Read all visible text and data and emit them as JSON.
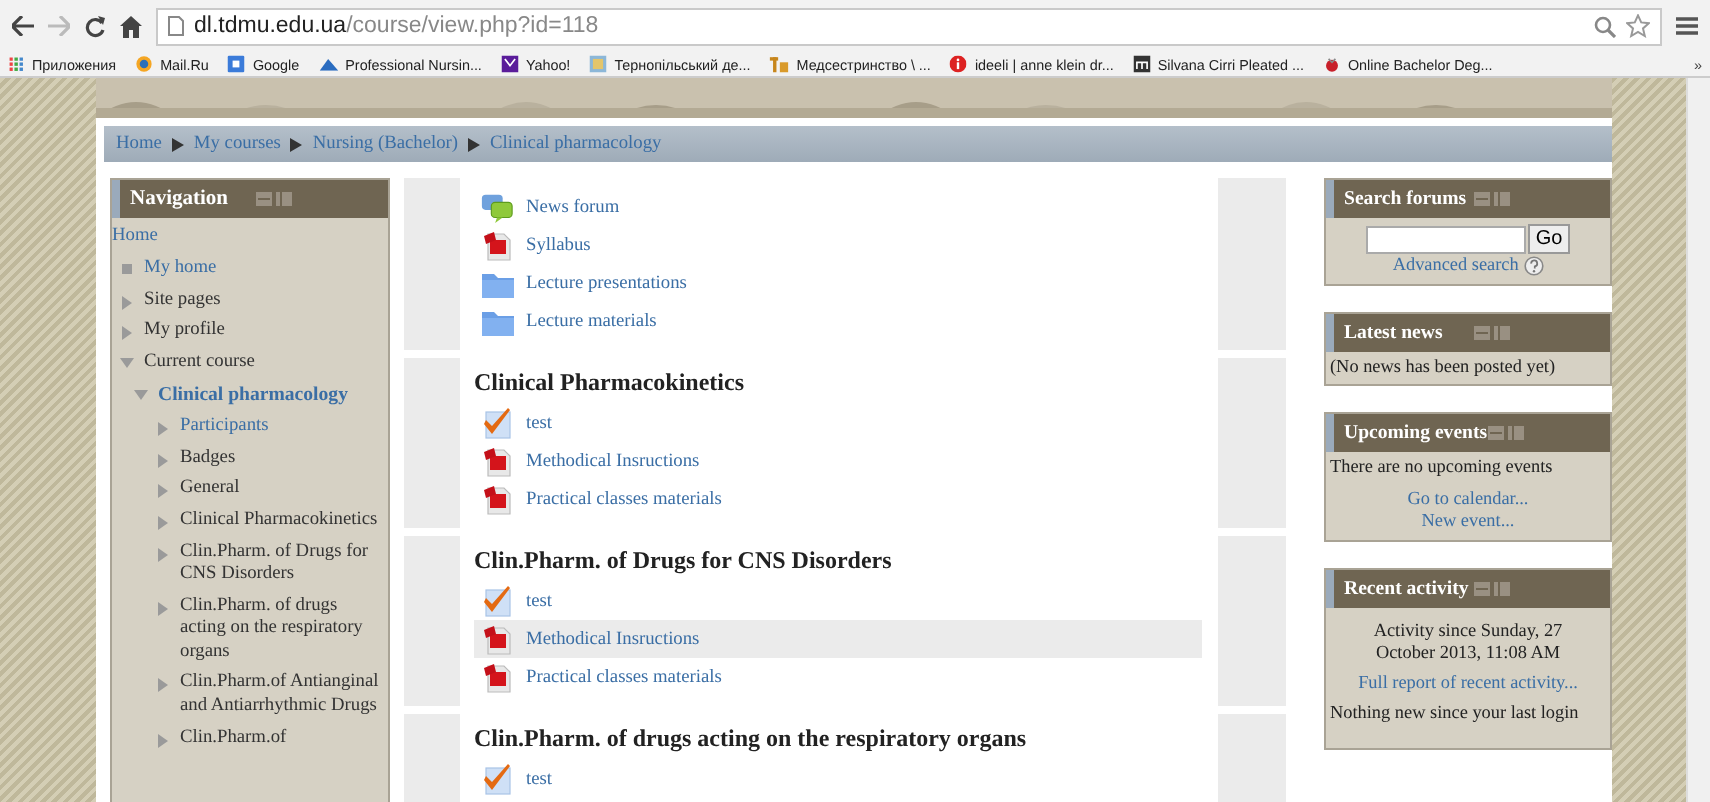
{
  "browser": {
    "url_host": "dl.tdmu.edu.ua",
    "url_path": "/course/view.php?id=118",
    "bookmarks": [
      {
        "kind": "apps",
        "label": "Приложения"
      },
      {
        "kind": "mail",
        "label": "Mail.Ru"
      },
      {
        "kind": "google",
        "label": "Google"
      },
      {
        "kind": "wave",
        "label": "Professional Nursin..."
      },
      {
        "kind": "yahoo",
        "label": "Yahoo!"
      },
      {
        "kind": "site",
        "label": "Тернопільський де..."
      },
      {
        "kind": "tn",
        "label": "Медсестринство \\ ..."
      },
      {
        "kind": "info",
        "label": "ideeli | anne klein dr..."
      },
      {
        "kind": "m",
        "label": "Silvana Cirri Pleated ..."
      },
      {
        "kind": "bird",
        "label": "Online Bachelor Deg..."
      }
    ],
    "more": "»"
  },
  "breadcrumb": [
    "Home",
    "My courses",
    "Nursing (Bachelor)",
    "Clinical pharmacology"
  ],
  "navigation": {
    "title": "Navigation",
    "items": [
      {
        "label": "Home",
        "kind": "plain",
        "link": true
      },
      {
        "label": "My home",
        "kind": "leaf",
        "link": true
      },
      {
        "label": "Site pages",
        "kind": "branch",
        "expanded": false,
        "link": false
      },
      {
        "label": "My profile",
        "kind": "branch",
        "expanded": false,
        "link": false
      },
      {
        "label": "Current course",
        "kind": "branch",
        "expanded": true,
        "link": false,
        "children": [
          {
            "label": "Clinical pharmacology",
            "kind": "branch",
            "expanded": true,
            "link": true,
            "current": true,
            "children": [
              {
                "label": "Participants",
                "kind": "branch",
                "expanded": false,
                "link": true
              },
              {
                "label": "Badges",
                "kind": "branch",
                "expanded": false,
                "link": false
              },
              {
                "label": "General",
                "kind": "branch",
                "expanded": false,
                "link": false
              },
              {
                "label": "Clinical Pharmacokinetics",
                "kind": "branch",
                "expanded": false,
                "link": false
              },
              {
                "label": "Clin.Pharm. of Drugs for CNS Disorders",
                "kind": "branch",
                "expanded": false,
                "link": false
              },
              {
                "label": "Clin.Pharm. of drugs acting on the respiratory organs",
                "kind": "branch",
                "expanded": false,
                "link": false
              },
              {
                "label": "Clin.Pharm.of Antianginal and Antiarrhythmic Drugs",
                "kind": "branch",
                "expanded": false,
                "link": false
              },
              {
                "label": "Clin.Pharm.of",
                "kind": "branch",
                "expanded": false,
                "link": false
              }
            ]
          }
        ]
      }
    ]
  },
  "sections": [
    {
      "activities": [
        {
          "kind": "forum",
          "label": "News forum",
          "highlighted": false
        },
        {
          "kind": "pdf",
          "label": "Syllabus",
          "highlighted": false
        },
        {
          "kind": "folder",
          "label": "Lecture presentations",
          "highlighted": false
        },
        {
          "kind": "folder",
          "label": "Lecture materials",
          "highlighted": false
        }
      ]
    },
    {
      "title": "Clinical Pharmacokinetics",
      "activities": [
        {
          "kind": "quiz",
          "label": "test",
          "highlighted": false
        },
        {
          "kind": "pdf",
          "label": "Methodical Insructions",
          "highlighted": false
        },
        {
          "kind": "pdf",
          "label": "Practical classes materials",
          "highlighted": false
        }
      ]
    },
    {
      "title": "Clin.Pharm. of Drugs for CNS Disorders",
      "activities": [
        {
          "kind": "quiz",
          "label": "test",
          "highlighted": false
        },
        {
          "kind": "pdf",
          "label": "Methodical Insructions",
          "highlighted": true
        },
        {
          "kind": "pdf",
          "label": "Practical classes materials",
          "highlighted": false
        }
      ]
    },
    {
      "title": "Clin.Pharm. of drugs acting on the respiratory organs",
      "activities": [
        {
          "kind": "quiz",
          "label": "test",
          "highlighted": false
        }
      ]
    }
  ],
  "blocks": [
    {
      "kind": "search",
      "title": "Search forums",
      "button": "Go",
      "link": "Advanced search"
    },
    {
      "kind": "text",
      "title": "Latest news",
      "text": "(No news has been posted yet)"
    },
    {
      "kind": "events",
      "title": "Upcoming events",
      "text": "There are no upcoming events",
      "links": [
        "Go to calendar...",
        "New event..."
      ]
    },
    {
      "kind": "activity",
      "title": "Recent activity",
      "since": "Activity since Sunday, 27 October 2013, 11:08 AM",
      "link": "Full report of recent activity...",
      "note": "Nothing new since your last login"
    }
  ]
}
